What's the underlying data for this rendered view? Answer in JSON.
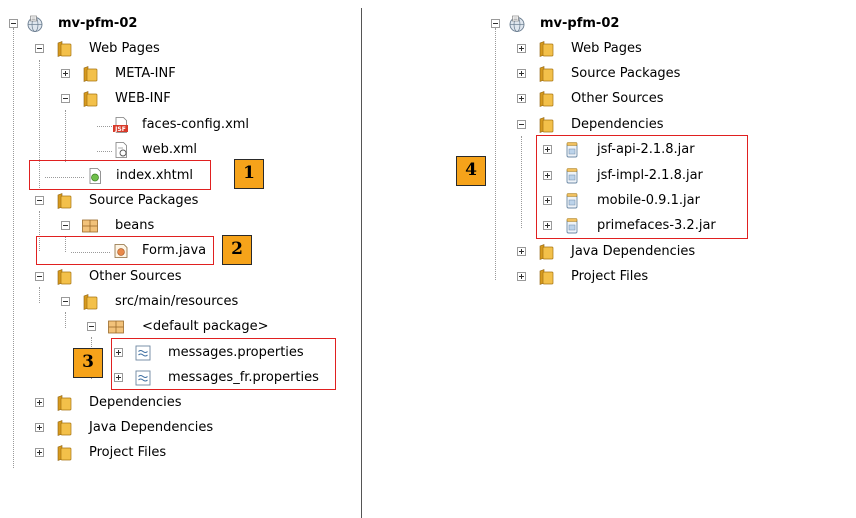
{
  "left_tree": {
    "project": "mv-pfm-02",
    "web_pages": "Web Pages",
    "meta_inf": "META-INF",
    "web_inf": "WEB-INF",
    "faces_config": "faces-config.xml",
    "web_xml": "web.xml",
    "index": "index.xhtml",
    "source_packages": "Source Packages",
    "beans": "beans",
    "form_java": "Form.java",
    "other_sources": "Other Sources",
    "resources": "src/main/resources",
    "default_package": "<default package>",
    "messages": "messages.properties",
    "messages_fr": "messages_fr.properties",
    "dependencies": "Dependencies",
    "java_dependencies": "Java Dependencies",
    "project_files": "Project Files"
  },
  "right_tree": {
    "project": "mv-pfm-02",
    "web_pages": "Web Pages",
    "source_packages": "Source Packages",
    "other_sources": "Other Sources",
    "dependencies": "Dependencies",
    "jars": [
      "jsf-api-2.1.8.jar",
      "jsf-impl-2.1.8.jar",
      "mobile-0.9.1.jar",
      "primefaces-3.2.jar"
    ],
    "java_dependencies": "Java Dependencies",
    "project_files": "Project Files"
  },
  "badges": {
    "b1": "1",
    "b2": "2",
    "b3": "3",
    "b4": "4"
  },
  "icon_text": {
    "jsf": "JSF"
  },
  "colors": {
    "highlight": "#e02020",
    "badge": "#f6a31a",
    "folder": "#f0b642"
  }
}
